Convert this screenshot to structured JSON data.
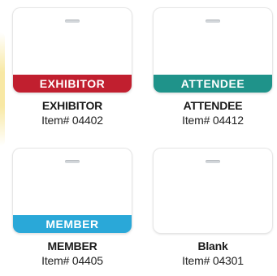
{
  "cards": [
    {
      "band_label": "EXHIBITOR",
      "band_color": "#c11f2f",
      "name": "EXHIBITOR",
      "item": "Item# 04402"
    },
    {
      "band_label": "ATTENDEE",
      "band_color": "#1f938a",
      "name": "ATTENDEE",
      "item": "Item# 04412"
    },
    {
      "band_label": "MEMBER",
      "band_color": "#2aa8d8",
      "name": "MEMBER",
      "item": "Item# 04405"
    },
    {
      "band_label": "",
      "band_color": "",
      "name": "Blank",
      "item": "Item# 04301"
    }
  ]
}
